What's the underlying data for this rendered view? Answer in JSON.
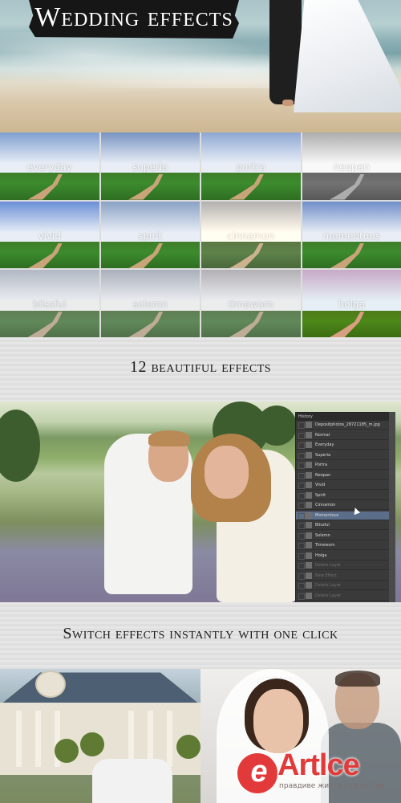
{
  "hero": {
    "title": "Wedding effects"
  },
  "effects": [
    {
      "label": "everyday",
      "sky": "#7f9fd0",
      "tone": "normal"
    },
    {
      "label": "superia",
      "sky": "#7794c2",
      "tone": "normal"
    },
    {
      "label": "portra",
      "sky": "#8ea7d3",
      "tone": "normal"
    },
    {
      "label": "neopan",
      "sky": "#a9a9a9",
      "tone": "bw"
    },
    {
      "label": "vivid",
      "sky": "#6a8fd6",
      "tone": "normal"
    },
    {
      "label": "spirit",
      "sky": "#8aa2c4",
      "tone": "normal"
    },
    {
      "label": "cinnamon",
      "sky": "#9ba4b8",
      "tone": "warm"
    },
    {
      "label": "momentous",
      "sky": "#6f8ec8",
      "tone": "normal"
    },
    {
      "label": "blissful",
      "sky": "#a8b4cc",
      "tone": "faded"
    },
    {
      "label": "solemn",
      "sky": "#9eaac0",
      "tone": "faded"
    },
    {
      "label": "timeworn",
      "sky": "#b0a9b3",
      "tone": "faded"
    },
    {
      "label": "holga",
      "sky": "#c9a9bf",
      "tone": "pink"
    }
  ],
  "caption1": "12 beautiful effects",
  "caption2": "Switch effects instantly with one click",
  "history_panel": {
    "title": "History",
    "items": [
      {
        "label": "Depositphotos_28721185_m.jpg",
        "state": "file"
      },
      {
        "label": "Normal",
        "state": "normal"
      },
      {
        "label": "Everyday",
        "state": "normal"
      },
      {
        "label": "Superia",
        "state": "normal"
      },
      {
        "label": "Portra",
        "state": "normal"
      },
      {
        "label": "Neopan",
        "state": "normal"
      },
      {
        "label": "Vivid",
        "state": "normal"
      },
      {
        "label": "Spirit",
        "state": "normal"
      },
      {
        "label": "Cinnamon",
        "state": "normal"
      },
      {
        "label": "Momentous",
        "state": "selected"
      },
      {
        "label": "Blissful",
        "state": "normal"
      },
      {
        "label": "Solemn",
        "state": "normal"
      },
      {
        "label": "Timeworn",
        "state": "normal"
      },
      {
        "label": "Holga",
        "state": "normal"
      },
      {
        "label": "Delete Layer",
        "state": "dim"
      },
      {
        "label": "New Effect",
        "state": "dim"
      },
      {
        "label": "Delete Layer",
        "state": "dim"
      },
      {
        "label": "Delete Layer",
        "state": "dim"
      }
    ]
  },
  "watermark": {
    "logo_letter": "e",
    "text": "Artlce",
    "sub": "правдиве життя кожної іди"
  }
}
